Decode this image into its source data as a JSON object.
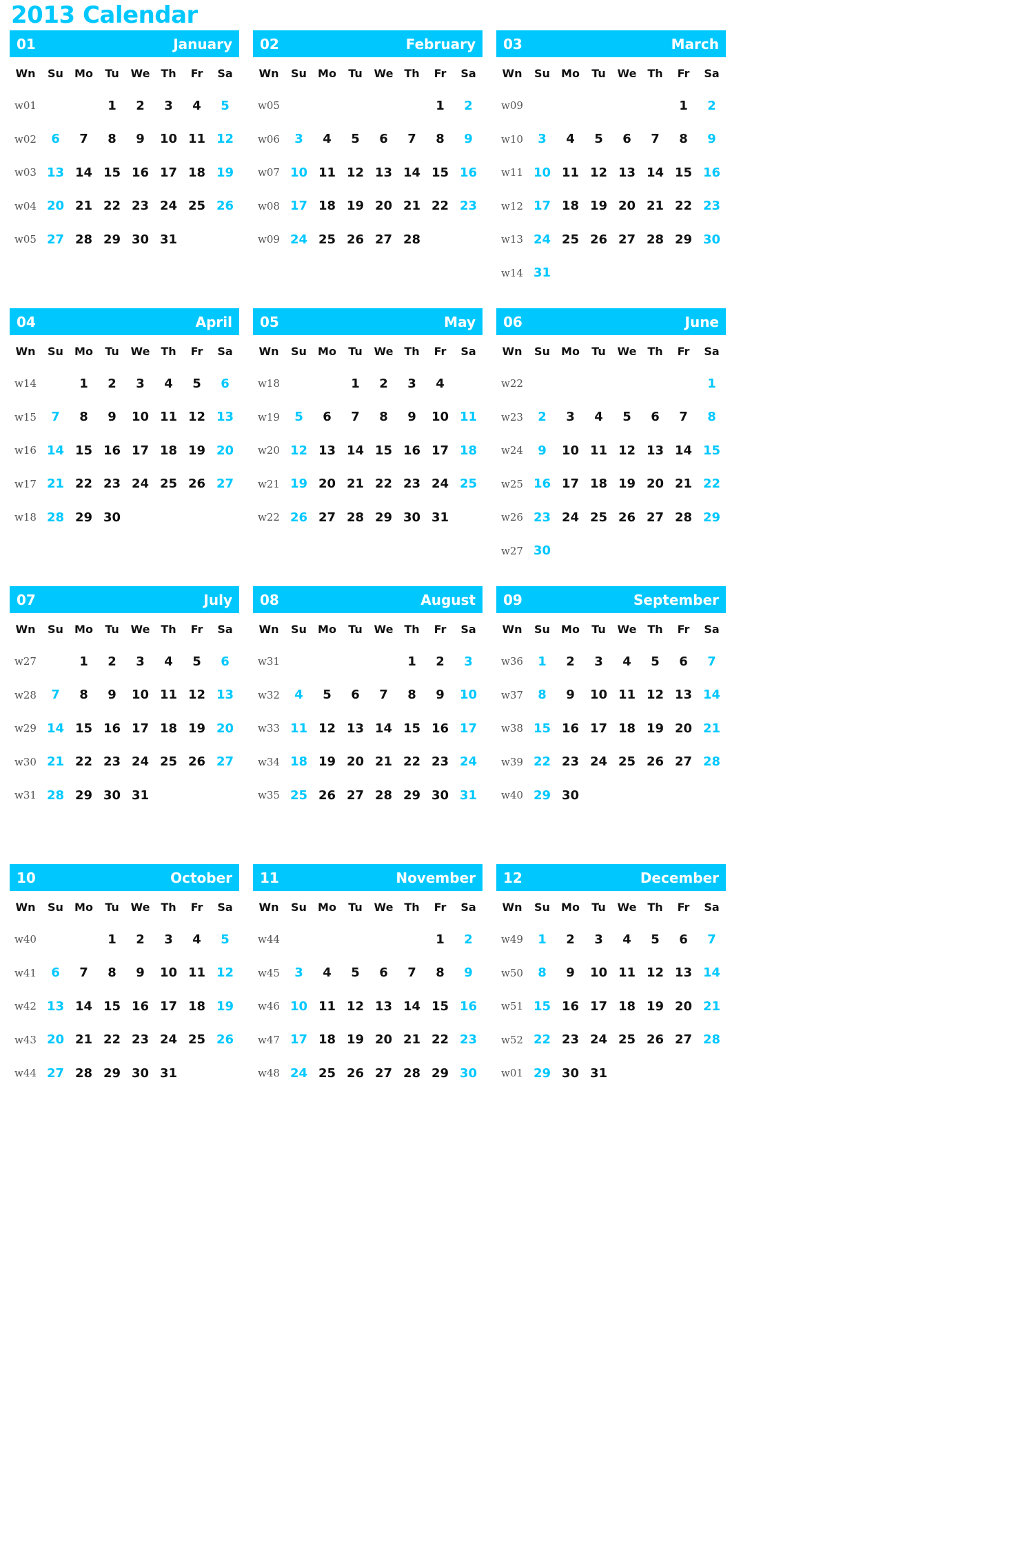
{
  "title": "2013 Calendar",
  "accent_color": "#00c8ff",
  "text_color": "#111111",
  "week_number_color": "#555555",
  "weekday_headers": [
    "Wn",
    "Su",
    "Mo",
    "Tu",
    "We",
    "Th",
    "Fr",
    "Sa"
  ],
  "weekend_columns": [
    1,
    7
  ],
  "months": [
    {
      "number": "01",
      "name": "January",
      "weeks": [
        {
          "wn": "w01",
          "days": [
            "",
            "",
            "1",
            "2",
            "3",
            "4",
            "5"
          ]
        },
        {
          "wn": "w02",
          "days": [
            "6",
            "7",
            "8",
            "9",
            "10",
            "11",
            "12"
          ]
        },
        {
          "wn": "w03",
          "days": [
            "13",
            "14",
            "15",
            "16",
            "17",
            "18",
            "19"
          ]
        },
        {
          "wn": "w04",
          "days": [
            "20",
            "21",
            "22",
            "23",
            "24",
            "25",
            "26"
          ]
        },
        {
          "wn": "w05",
          "days": [
            "27",
            "28",
            "29",
            "30",
            "31",
            "",
            ""
          ]
        }
      ]
    },
    {
      "number": "02",
      "name": "February",
      "weeks": [
        {
          "wn": "w05",
          "days": [
            "",
            "",
            "",
            "",
            "",
            "1",
            "2"
          ]
        },
        {
          "wn": "w06",
          "days": [
            "3",
            "4",
            "5",
            "6",
            "7",
            "8",
            "9"
          ]
        },
        {
          "wn": "w07",
          "days": [
            "10",
            "11",
            "12",
            "13",
            "14",
            "15",
            "16"
          ]
        },
        {
          "wn": "w08",
          "days": [
            "17",
            "18",
            "19",
            "20",
            "21",
            "22",
            "23"
          ]
        },
        {
          "wn": "w09",
          "days": [
            "24",
            "25",
            "26",
            "27",
            "28",
            "",
            ""
          ]
        }
      ]
    },
    {
      "number": "03",
      "name": "March",
      "weeks": [
        {
          "wn": "w09",
          "days": [
            "",
            "",
            "",
            "",
            "",
            "1",
            "2"
          ]
        },
        {
          "wn": "w10",
          "days": [
            "3",
            "4",
            "5",
            "6",
            "7",
            "8",
            "9"
          ]
        },
        {
          "wn": "w11",
          "days": [
            "10",
            "11",
            "12",
            "13",
            "14",
            "15",
            "16"
          ]
        },
        {
          "wn": "w12",
          "days": [
            "17",
            "18",
            "19",
            "20",
            "21",
            "22",
            "23"
          ]
        },
        {
          "wn": "w13",
          "days": [
            "24",
            "25",
            "26",
            "27",
            "28",
            "29",
            "30"
          ]
        },
        {
          "wn": "w14",
          "days": [
            "31",
            "",
            "",
            "",
            "",
            "",
            ""
          ]
        }
      ]
    },
    {
      "number": "04",
      "name": "April",
      "weeks": [
        {
          "wn": "w14",
          "days": [
            "",
            "1",
            "2",
            "3",
            "4",
            "5",
            "6"
          ]
        },
        {
          "wn": "w15",
          "days": [
            "7",
            "8",
            "9",
            "10",
            "11",
            "12",
            "13"
          ]
        },
        {
          "wn": "w16",
          "days": [
            "14",
            "15",
            "16",
            "17",
            "18",
            "19",
            "20"
          ]
        },
        {
          "wn": "w17",
          "days": [
            "21",
            "22",
            "23",
            "24",
            "25",
            "26",
            "27"
          ]
        },
        {
          "wn": "w18",
          "days": [
            "28",
            "29",
            "30",
            "",
            "",
            "",
            ""
          ]
        }
      ]
    },
    {
      "number": "05",
      "name": "May",
      "weeks": [
        {
          "wn": "w18",
          "days": [
            "",
            "",
            "1",
            "2",
            "3",
            "4",
            ""
          ]
        },
        {
          "wn": "w19",
          "days": [
            "5",
            "6",
            "7",
            "8",
            "9",
            "10",
            "11"
          ]
        },
        {
          "wn": "w20",
          "days": [
            "12",
            "13",
            "14",
            "15",
            "16",
            "17",
            "18"
          ]
        },
        {
          "wn": "w21",
          "days": [
            "19",
            "20",
            "21",
            "22",
            "23",
            "24",
            "25"
          ]
        },
        {
          "wn": "w22",
          "days": [
            "26",
            "27",
            "28",
            "29",
            "30",
            "31",
            ""
          ]
        }
      ]
    },
    {
      "number": "06",
      "name": "June",
      "weeks": [
        {
          "wn": "w22",
          "days": [
            "",
            "",
            "",
            "",
            "",
            "",
            "1"
          ]
        },
        {
          "wn": "w23",
          "days": [
            "2",
            "3",
            "4",
            "5",
            "6",
            "7",
            "8"
          ]
        },
        {
          "wn": "w24",
          "days": [
            "9",
            "10",
            "11",
            "12",
            "13",
            "14",
            "15"
          ]
        },
        {
          "wn": "w25",
          "days": [
            "16",
            "17",
            "18",
            "19",
            "20",
            "21",
            "22"
          ]
        },
        {
          "wn": "w26",
          "days": [
            "23",
            "24",
            "25",
            "26",
            "27",
            "28",
            "29"
          ]
        },
        {
          "wn": "w27",
          "days": [
            "30",
            "",
            "",
            "",
            "",
            "",
            ""
          ]
        }
      ]
    },
    {
      "number": "07",
      "name": "July",
      "weeks": [
        {
          "wn": "w27",
          "days": [
            "",
            "1",
            "2",
            "3",
            "4",
            "5",
            "6"
          ]
        },
        {
          "wn": "w28",
          "days": [
            "7",
            "8",
            "9",
            "10",
            "11",
            "12",
            "13"
          ]
        },
        {
          "wn": "w29",
          "days": [
            "14",
            "15",
            "16",
            "17",
            "18",
            "19",
            "20"
          ]
        },
        {
          "wn": "w30",
          "days": [
            "21",
            "22",
            "23",
            "24",
            "25",
            "26",
            "27"
          ]
        },
        {
          "wn": "w31",
          "days": [
            "28",
            "29",
            "30",
            "31",
            "",
            "",
            ""
          ]
        }
      ]
    },
    {
      "number": "08",
      "name": "August",
      "weeks": [
        {
          "wn": "w31",
          "days": [
            "",
            "",
            "",
            "",
            "1",
            "2",
            "3"
          ]
        },
        {
          "wn": "w32",
          "days": [
            "4",
            "5",
            "6",
            "7",
            "8",
            "9",
            "10"
          ]
        },
        {
          "wn": "w33",
          "days": [
            "11",
            "12",
            "13",
            "14",
            "15",
            "16",
            "17"
          ]
        },
        {
          "wn": "w34",
          "days": [
            "18",
            "19",
            "20",
            "21",
            "22",
            "23",
            "24"
          ]
        },
        {
          "wn": "w35",
          "days": [
            "25",
            "26",
            "27",
            "28",
            "29",
            "30",
            "31"
          ]
        }
      ]
    },
    {
      "number": "09",
      "name": "September",
      "weeks": [
        {
          "wn": "w36",
          "days": [
            "1",
            "2",
            "3",
            "4",
            "5",
            "6",
            "7"
          ]
        },
        {
          "wn": "w37",
          "days": [
            "8",
            "9",
            "10",
            "11",
            "12",
            "13",
            "14"
          ]
        },
        {
          "wn": "w38",
          "days": [
            "15",
            "16",
            "17",
            "18",
            "19",
            "20",
            "21"
          ]
        },
        {
          "wn": "w39",
          "days": [
            "22",
            "23",
            "24",
            "25",
            "26",
            "27",
            "28"
          ]
        },
        {
          "wn": "w40",
          "days": [
            "29",
            "30",
            "",
            "",
            "",
            "",
            ""
          ]
        }
      ]
    },
    {
      "number": "10",
      "name": "October",
      "weeks": [
        {
          "wn": "w40",
          "days": [
            "",
            "",
            "1",
            "2",
            "3",
            "4",
            "5"
          ]
        },
        {
          "wn": "w41",
          "days": [
            "6",
            "7",
            "8",
            "9",
            "10",
            "11",
            "12"
          ]
        },
        {
          "wn": "w42",
          "days": [
            "13",
            "14",
            "15",
            "16",
            "17",
            "18",
            "19"
          ]
        },
        {
          "wn": "w43",
          "days": [
            "20",
            "21",
            "22",
            "23",
            "24",
            "25",
            "26"
          ]
        },
        {
          "wn": "w44",
          "days": [
            "27",
            "28",
            "29",
            "30",
            "31",
            "",
            ""
          ]
        }
      ]
    },
    {
      "number": "11",
      "name": "November",
      "weeks": [
        {
          "wn": "w44",
          "days": [
            "",
            "",
            "",
            "",
            "",
            "1",
            "2"
          ]
        },
        {
          "wn": "w45",
          "days": [
            "3",
            "4",
            "5",
            "6",
            "7",
            "8",
            "9"
          ]
        },
        {
          "wn": "w46",
          "days": [
            "10",
            "11",
            "12",
            "13",
            "14",
            "15",
            "16"
          ]
        },
        {
          "wn": "w47",
          "days": [
            "17",
            "18",
            "19",
            "20",
            "21",
            "22",
            "23"
          ]
        },
        {
          "wn": "w48",
          "days": [
            "24",
            "25",
            "26",
            "27",
            "28",
            "29",
            "30"
          ]
        }
      ]
    },
    {
      "number": "12",
      "name": "December",
      "weeks": [
        {
          "wn": "w49",
          "days": [
            "1",
            "2",
            "3",
            "4",
            "5",
            "6",
            "7"
          ]
        },
        {
          "wn": "w50",
          "days": [
            "8",
            "9",
            "10",
            "11",
            "12",
            "13",
            "14"
          ]
        },
        {
          "wn": "w51",
          "days": [
            "15",
            "16",
            "17",
            "18",
            "19",
            "20",
            "21"
          ]
        },
        {
          "wn": "w52",
          "days": [
            "22",
            "23",
            "24",
            "25",
            "26",
            "27",
            "28"
          ]
        },
        {
          "wn": "w01",
          "days": [
            "29",
            "30",
            "31",
            "",
            "",
            "",
            ""
          ]
        }
      ]
    }
  ]
}
